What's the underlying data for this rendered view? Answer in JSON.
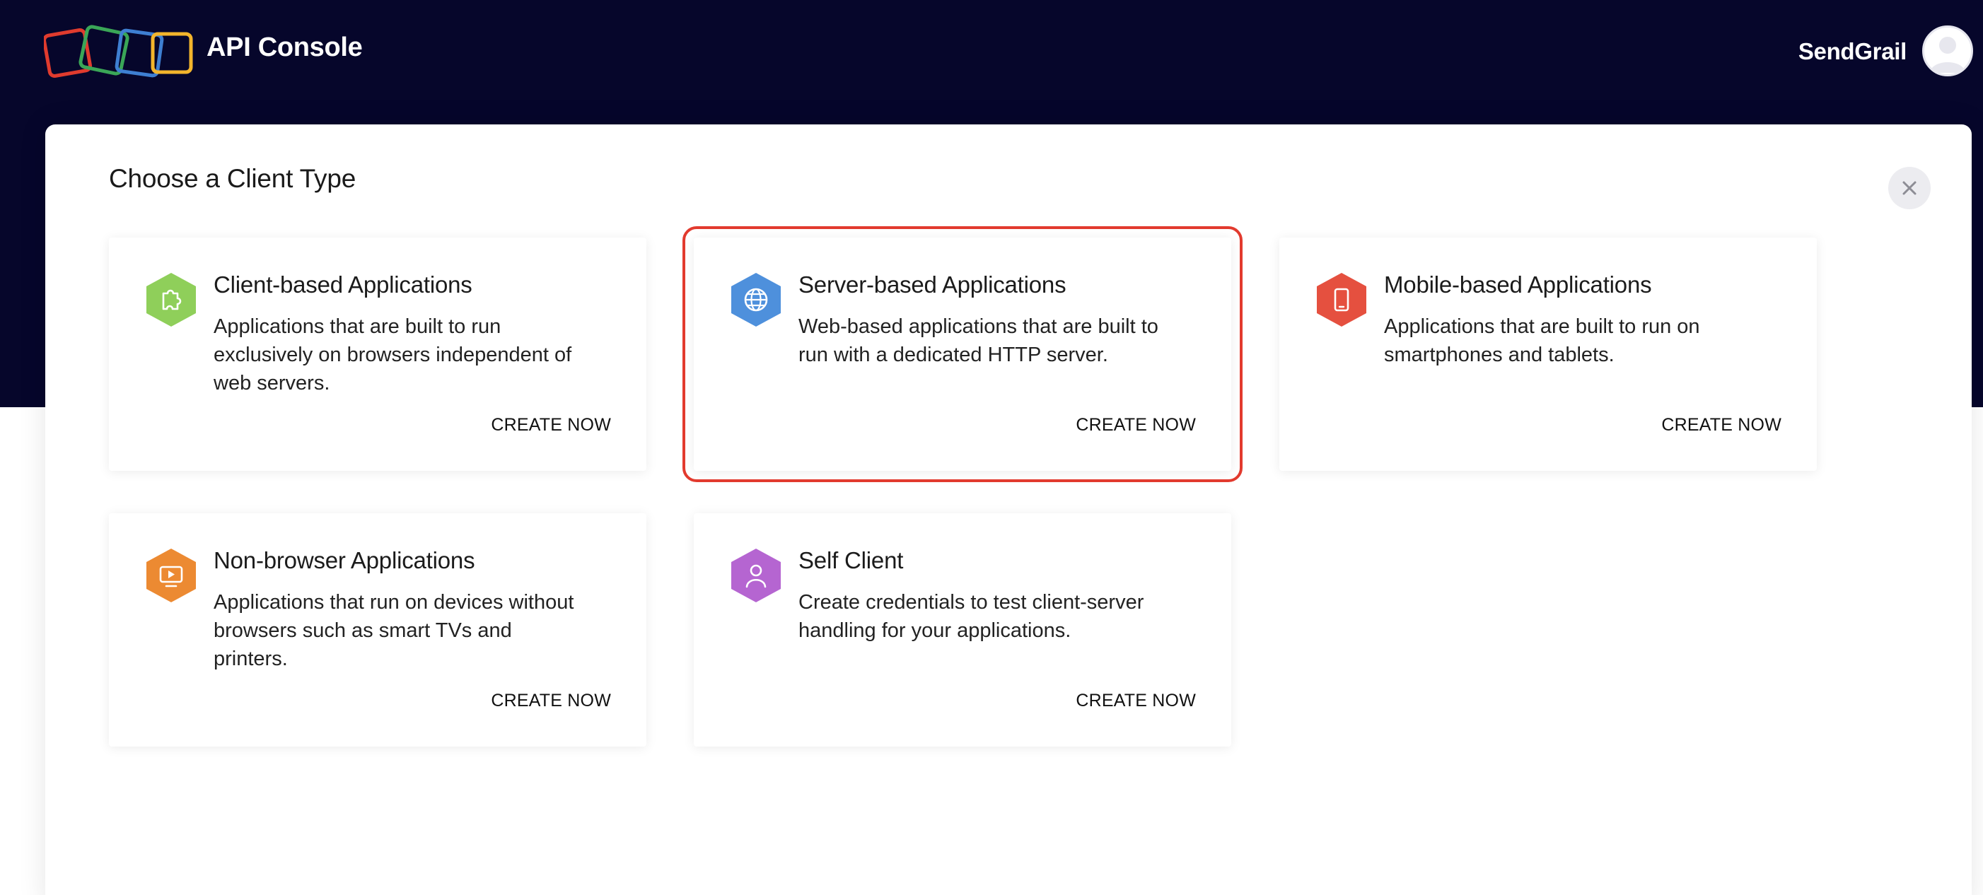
{
  "header": {
    "app_title": "API Console",
    "account_name": "SendGrail"
  },
  "modal": {
    "title": "Choose a Client Type"
  },
  "colors": {
    "header_bg": "#06062b",
    "selection_outline": "#e23a2e",
    "logo_squares": [
      "#e03b2e",
      "#3aa657",
      "#3e7fd2",
      "#f3b52c"
    ]
  },
  "cards": [
    {
      "title": "Client-based Applications",
      "description": "Applications that are built to run exclusively on browsers independent of web servers.",
      "action": "CREATE NOW",
      "icon": "puzzle-icon",
      "color": "#8fcf5a"
    },
    {
      "title": "Server-based Applications",
      "description": "Web-based applications that are built to run with a dedicated HTTP server.",
      "action": "CREATE NOW",
      "icon": "globe-icon",
      "color": "#4e90dc",
      "selected": true
    },
    {
      "title": "Mobile-based Applications",
      "description": "Applications that are built to run on smartphones and tablets.",
      "action": "CREATE NOW",
      "icon": "mobile-phone-icon",
      "color": "#e5503f"
    },
    {
      "title": "Non-browser Applications",
      "description": "Applications that run on devices without browsers such as smart TVs and printers.",
      "action": "CREATE NOW",
      "icon": "tv-icon",
      "color": "#ec8a32"
    },
    {
      "title": "Self Client",
      "description": "Create credentials to test client-server handling for your applications.",
      "action": "CREATE NOW",
      "icon": "user-icon",
      "color": "#b565d1"
    }
  ]
}
